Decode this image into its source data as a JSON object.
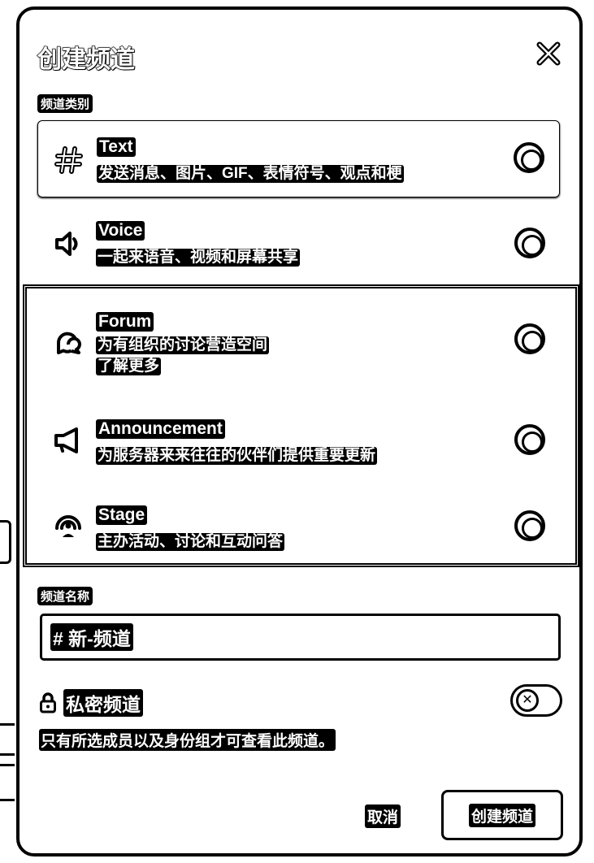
{
  "dialog": {
    "title": "创建频道",
    "category_label": "频道类别",
    "options": [
      {
        "name": "Text",
        "desc": "发送消息、图片、GIF、表情符号、观点和梗",
        "icon": "hash-icon",
        "selected": true
      },
      {
        "name": "Voice",
        "desc": "一起来语音、视频和屏幕共享",
        "icon": "speaker-icon",
        "selected": false
      },
      {
        "name": "Forum",
        "desc": "为有组织的讨论营造空间",
        "learn_more": "了解更多",
        "icon": "forum-icon",
        "selected": false
      },
      {
        "name": "Announcement",
        "desc": "为服务器来来往往的伙伴们提供重要更新",
        "icon": "megaphone-icon",
        "selected": false
      },
      {
        "name": "Stage",
        "desc": "主办活动、讨论和互动问答",
        "icon": "stage-icon",
        "selected": false
      }
    ],
    "name_label": "频道名称",
    "name_value": "# 新-频道",
    "private_label": "私密频道",
    "private_desc": "只有所选成员以及身份组才可查看此频道。",
    "private_enabled": false,
    "cancel_label": "取消",
    "create_label": "创建频道"
  }
}
